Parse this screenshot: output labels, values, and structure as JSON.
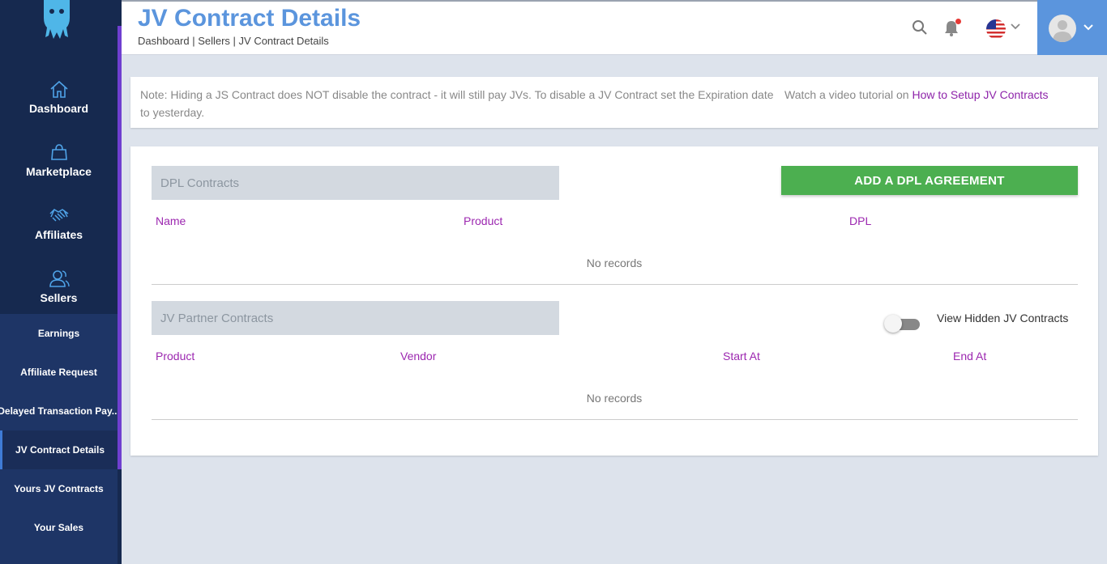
{
  "sidebar": {
    "main_items": [
      {
        "label": "Dashboard",
        "icon": "home-icon"
      },
      {
        "label": "Marketplace",
        "icon": "shopping-bag-icon"
      },
      {
        "label": "Affiliates",
        "icon": "handshake-icon"
      },
      {
        "label": "Sellers",
        "icon": "users-icon"
      }
    ],
    "sub_items": [
      {
        "label": "Earnings"
      },
      {
        "label": "Affiliate Request"
      },
      {
        "label": "Delayed Transaction Pay..."
      },
      {
        "label": "JV Contract Details",
        "active": true
      },
      {
        "label": "Yours JV Contracts"
      },
      {
        "label": "Your Sales"
      }
    ]
  },
  "header": {
    "title": "JV Contract Details",
    "breadcrumb": "Dashboard | Sellers | JV Contract Details"
  },
  "note": {
    "text": "Note: Hiding a JS Contract does NOT disable the contract - it will still pay JVs. To disable a JV Contract set the Expiration date to yesterday.",
    "tutorial_prefix": "Watch a video tutorial on ",
    "tutorial_link": "How to Setup JV Contracts"
  },
  "dpl": {
    "title": "DPL Contracts",
    "add_button": "ADD A DPL AGREEMENT",
    "columns": [
      "Name",
      "Product",
      "DPL"
    ],
    "empty": "No records"
  },
  "jv": {
    "title": "JV Partner Contracts",
    "toggle_label": "View Hidden JV Contracts",
    "toggle_on": false,
    "columns": [
      "Product",
      "Vendor",
      "Start At",
      "End At"
    ],
    "empty": "No records"
  },
  "colors": {
    "sidebar_bg": "#16294f",
    "accent_blue": "#5b95dd",
    "link_purple": "#9c27b0",
    "button_green": "#4caf50"
  }
}
